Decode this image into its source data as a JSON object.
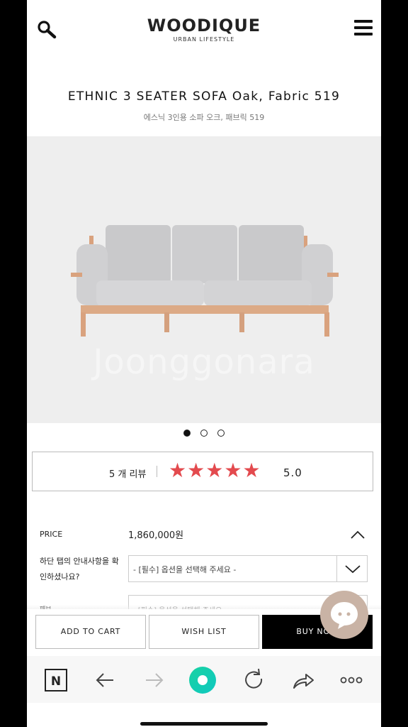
{
  "header": {
    "logo_main": "WOODIQUE",
    "logo_sub": "URBAN LIFESTYLE"
  },
  "product": {
    "title": "ETHNIC 3 SEATER SOFA Oak, Fabric 519",
    "subtitle": "에스닉 3인용 소파 오크, 패브릭 519",
    "watermark": "Joonggonara"
  },
  "gallery": {
    "dot_count": 3,
    "active_index": 0
  },
  "review": {
    "count_label": "5 개 리뷰",
    "stars": 5,
    "rating": "5.0",
    "star_color": "#e34a4e"
  },
  "price": {
    "label": "PRICE",
    "value": "1,860,000원"
  },
  "options": {
    "notice_label": "하단 탭의 안내사항을 확인하셨나요?",
    "select_placeholder": "- [필수] 옵션을 선택해 주세요 -",
    "second_label": "패브",
    "second_placeholder": "- [필수] 옵션을 선택해 주세요 -"
  },
  "actions": {
    "add_to_cart": "ADD TO CART",
    "wish_list": "WISH LIST",
    "buy_now": "BUY NOW"
  },
  "colors": {
    "accent_green": "#19d3a2",
    "chat_fab": "#c9b3a5"
  },
  "browser_nav": {
    "icons": [
      "naver-n-icon",
      "back-arrow-icon",
      "forward-arrow-icon",
      "home-green-icon",
      "refresh-icon",
      "share-icon",
      "more-dots-icon"
    ]
  }
}
